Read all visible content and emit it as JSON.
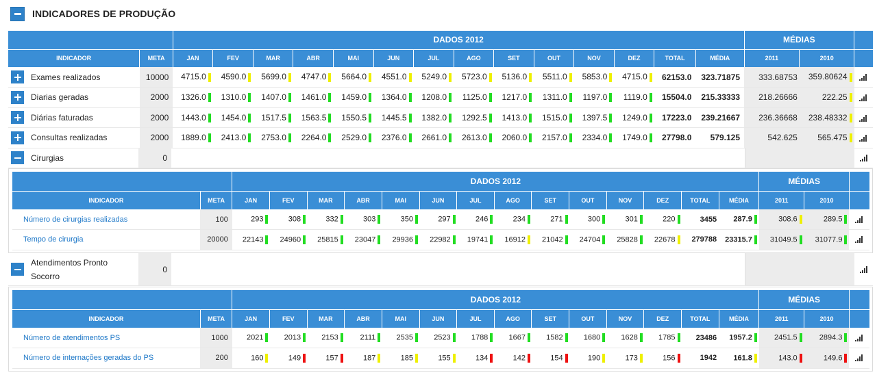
{
  "page": {
    "title": "INDICADORES DE PRODUÇÃO"
  },
  "headers": {
    "dados": "DADOS 2012",
    "medias": "MÉDIAS",
    "indicador": "INDICADOR",
    "meta": "META",
    "months": [
      "JAN",
      "FEV",
      "MAR",
      "ABR",
      "MAI",
      "JUN",
      "JUL",
      "AGO",
      "SET",
      "OUT",
      "NOV",
      "DEZ"
    ],
    "total": "TOTAL",
    "media": "MÉDIA",
    "y2011": "2011",
    "y2010": "2010"
  },
  "colors": {
    "header_blue": "#3a8ed6",
    "green": "#22dd22",
    "yellow": "#eef000",
    "red": "#ee1111",
    "link": "#1e78c8"
  },
  "main_rows": [
    {
      "name": "Exames realizados",
      "meta": "10000",
      "months": [
        "4715.0",
        "4590.0",
        "5699.0",
        "4747.0",
        "5664.0",
        "4551.0",
        "5249.0",
        "5723.0",
        "5136.0",
        "5511.0",
        "5853.0",
        "4715.0"
      ],
      "marks": [
        "y",
        "y",
        "y",
        "y",
        "y",
        "y",
        "y",
        "y",
        "y",
        "y",
        "y",
        "y"
      ],
      "total": "62153.0",
      "media": "323.71875",
      "m2011": "333.68753",
      "m2010": "359.80624",
      "mark2010": "y"
    },
    {
      "name": "Diarias geradas",
      "meta": "2000",
      "months": [
        "1326.0",
        "1310.0",
        "1407.0",
        "1461.0",
        "1459.0",
        "1364.0",
        "1208.0",
        "1125.0",
        "1217.0",
        "1311.0",
        "1197.0",
        "1119.0"
      ],
      "marks": [
        "g",
        "g",
        "g",
        "g",
        "g",
        "g",
        "g",
        "g",
        "g",
        "g",
        "g",
        "g"
      ],
      "total": "15504.0",
      "media": "215.33333",
      "m2011": "218.26666",
      "m2010": "222.25",
      "mark2010": "y"
    },
    {
      "name": "Diárias faturadas",
      "meta": "2000",
      "months": [
        "1443.0",
        "1454.0",
        "1517.5",
        "1563.5",
        "1550.5",
        "1445.5",
        "1382.0",
        "1292.5",
        "1413.0",
        "1515.0",
        "1397.5",
        "1249.0"
      ],
      "marks": [
        "g",
        "g",
        "g",
        "g",
        "g",
        "g",
        "g",
        "g",
        "g",
        "g",
        "g",
        "g"
      ],
      "total": "17223.0",
      "media": "239.21667",
      "m2011": "236.36668",
      "m2010": "238.48332",
      "mark2010": "y"
    },
    {
      "name": "Consultas realizadas",
      "meta": "2000",
      "months": [
        "1889.0",
        "2413.0",
        "2753.0",
        "2264.0",
        "2529.0",
        "2376.0",
        "2661.0",
        "2613.0",
        "2060.0",
        "2157.0",
        "2334.0",
        "1749.0"
      ],
      "marks": [
        "g",
        "g",
        "g",
        "g",
        "g",
        "g",
        "g",
        "g",
        "g",
        "g",
        "g",
        "g"
      ],
      "total": "27798.0",
      "media": "579.125",
      "m2011": "542.625",
      "m2010": "565.475",
      "mark2010": "y"
    }
  ],
  "groups": [
    {
      "name": "Cirurgias",
      "meta": "0",
      "rows": [
        {
          "name": "Número de cirurgias realizadas",
          "meta": "100",
          "months": [
            "293",
            "308",
            "332",
            "303",
            "350",
            "297",
            "246",
            "234",
            "271",
            "300",
            "301",
            "220"
          ],
          "marks": [
            "g",
            "g",
            "g",
            "g",
            "g",
            "g",
            "g",
            "g",
            "g",
            "g",
            "g",
            "g"
          ],
          "total": "3455",
          "media": "287.9",
          "mark_media": "g",
          "m2011": "308.6",
          "mark2011": "y",
          "m2010": "289.5",
          "mark2010": "g"
        },
        {
          "name": "Tempo de cirurgia",
          "meta": "20000",
          "months": [
            "22143",
            "24960",
            "25815",
            "23047",
            "29936",
            "22982",
            "19741",
            "16912",
            "21042",
            "24704",
            "25828",
            "22678"
          ],
          "marks": [
            "g",
            "g",
            "g",
            "g",
            "g",
            "g",
            "g",
            "y",
            "g",
            "g",
            "g",
            "y"
          ],
          "total": "279788",
          "media": "23315.7",
          "mark_media": "g",
          "m2011": "31049.5",
          "mark2011": "g",
          "m2010": "31077.9",
          "mark2010": "g"
        }
      ]
    },
    {
      "name": "Atendimentos Pronto Socorro",
      "meta": "0",
      "rows": [
        {
          "name": "Número de atendimentos PS",
          "meta": "1000",
          "months": [
            "2021",
            "2013",
            "2153",
            "2111",
            "2535",
            "2523",
            "1788",
            "1667",
            "1582",
            "1680",
            "1628",
            "1785"
          ],
          "marks": [
            "g",
            "g",
            "g",
            "g",
            "g",
            "g",
            "g",
            "g",
            "g",
            "g",
            "g",
            "g"
          ],
          "total": "23486",
          "media": "1957.2",
          "mark_media": "g",
          "m2011": "2451.5",
          "mark2011": "g",
          "m2010": "2894.3",
          "mark2010": "g"
        },
        {
          "name": "Número de internações geradas do PS",
          "meta": "200",
          "months": [
            "160",
            "149",
            "157",
            "187",
            "185",
            "155",
            "134",
            "142",
            "154",
            "190",
            "173",
            "156"
          ],
          "marks": [
            "y",
            "r",
            "r",
            "y",
            "y",
            "y",
            "r",
            "r",
            "r",
            "y",
            "y",
            "r"
          ],
          "total": "1942",
          "media": "161.8",
          "mark_media": "y",
          "m2011": "143.0",
          "mark2011": "r",
          "m2010": "149.6",
          "mark2010": "r"
        }
      ]
    }
  ]
}
